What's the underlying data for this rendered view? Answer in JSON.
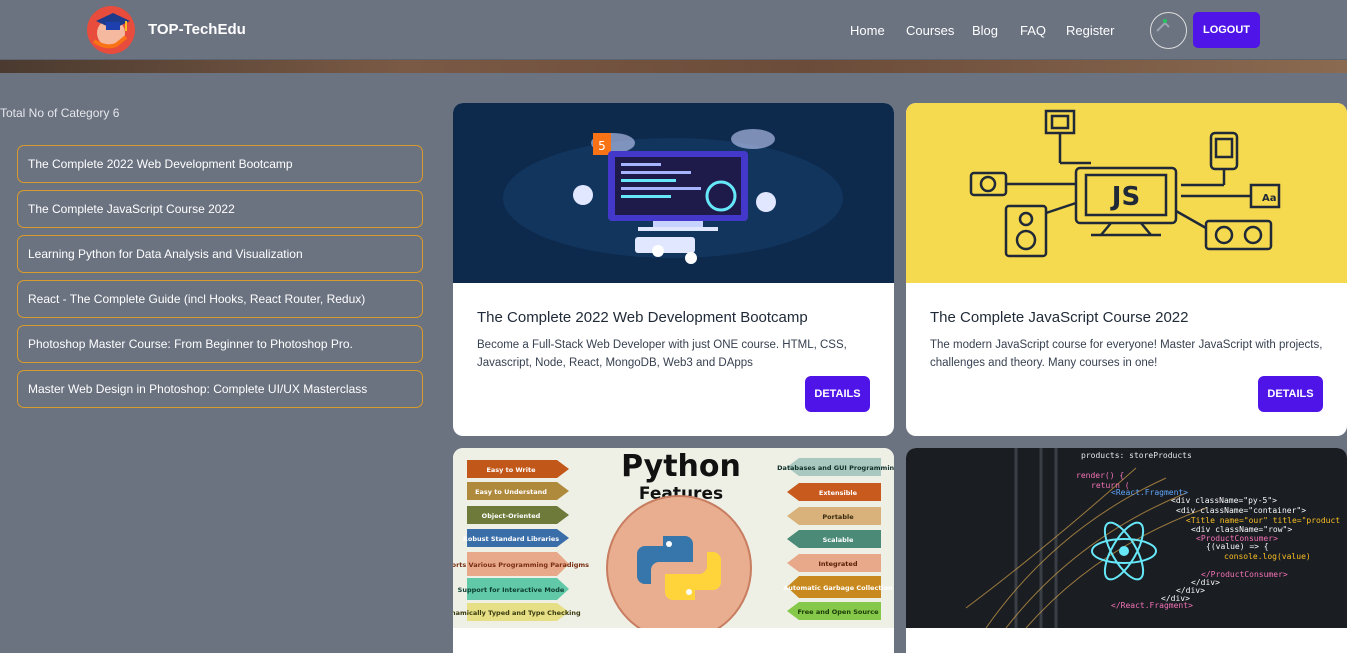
{
  "brand": {
    "name": "TOP-TechEdu"
  },
  "nav": {
    "links": [
      "Home",
      "Courses",
      "Blog",
      "FAQ",
      "Register"
    ],
    "logout_label": "LOGOUT"
  },
  "sidebar": {
    "count_label": "Total No of Category 6",
    "items": [
      {
        "label": "The Complete 2022 Web Development Bootcamp"
      },
      {
        "label": "The Complete JavaScript Course 2022"
      },
      {
        "label": "Learning Python for Data Analysis and Visualization"
      },
      {
        "label": "React - The Complete Guide (incl Hooks, React Router, Redux)"
      },
      {
        "label": "Photoshop Master Course: From Beginner to Photoshop Pro."
      },
      {
        "label": "Master Web Design in Photoshop: Complete UI/UX Masterclass"
      }
    ]
  },
  "cards": [
    {
      "title": "The Complete 2022 Web Development Bootcamp",
      "description": "Become a Full-Stack Web Developer with just ONE course. HTML, CSS, Javascript, Node, React, MongoDB, Web3 and DApps",
      "button_label": "DETAILS"
    },
    {
      "title": "The Complete JavaScript Course 2022",
      "description": "The modern JavaScript course for everyone! Master JavaScript with projects, challenges and theory. Many courses in one!",
      "button_label": "DETAILS",
      "image_text": "JS"
    },
    {
      "image_title": "Python",
      "image_subtitle": "Features",
      "features_left": [
        "Easy to Write",
        "Easy to Understand",
        "Object-Oriented",
        "Robust Standard Libraries",
        "Supports Various Programming Paradigms",
        "Support for Interactive Mode",
        "Dynamically Typed and Type Checking"
      ],
      "features_right": [
        "Databases and GUI Programming",
        "Extensible",
        "Portable",
        "Scalable",
        "Integrated",
        "Automatic Garbage Collection",
        "Free and Open Source"
      ]
    },
    {
      "code_lines": [
        "products: storeProducts",
        "render() {",
        "return (",
        "<React.Fragment>",
        "<div className=\"py-5\">",
        "<div className=\"container\">",
        "<Title name=\"our\" title=\"product",
        "<div className=\"row\">",
        "<ProductConsumer>",
        "{(value) => {",
        "console.log(value)",
        "</ProductConsumer>",
        "</div>",
        "</div>",
        "</div>",
        "</React.Fragment>"
      ]
    }
  ],
  "colors": {
    "background": "#6b7280",
    "accent": "#4f15e8",
    "category_border": "#d99b2b",
    "js_yellow": "#f5d94e",
    "web_dark": "#0d2a4d"
  }
}
